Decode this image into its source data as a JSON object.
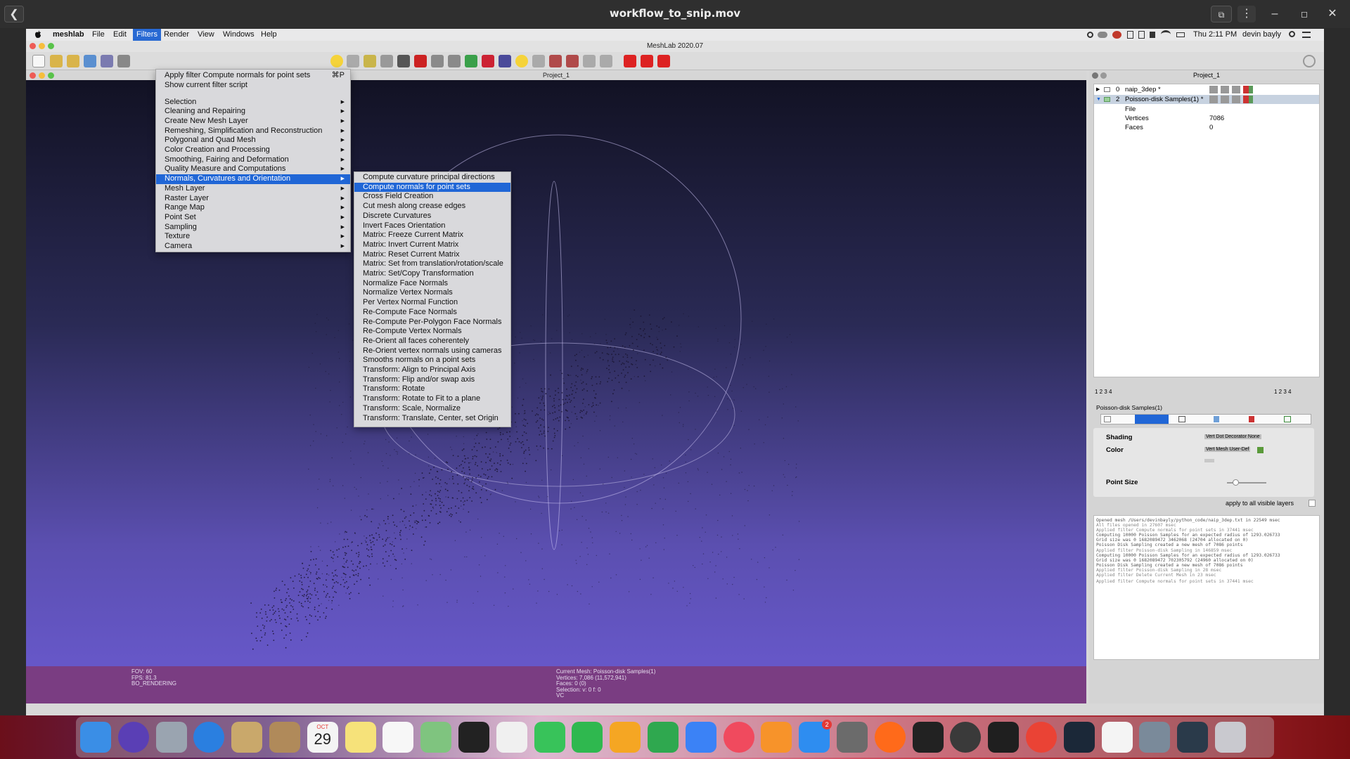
{
  "player": {
    "title": "workflow_to_snip.mov",
    "back_label": "❮",
    "right_box_label": "⧉",
    "menu_label": "⋮",
    "minimize_label": "–",
    "maximize_label": "◻",
    "close_label": "✕"
  },
  "menubar": {
    "app": "meshlab",
    "items": [
      "File",
      "Edit",
      "Filters",
      "Render",
      "View",
      "Windows",
      "Help"
    ],
    "active": "Filters",
    "clock": "Thu 2:11 PM",
    "user": "devin bayly"
  },
  "window": {
    "title": "MeshLab 2020.07"
  },
  "viewport": {
    "title": "Project_1",
    "fov": "FOV: 60",
    "fps": "FPS:   81.3",
    "rendering": "BO_RENDERING",
    "current_mesh": "Current Mesh: Poisson-disk Samples(1)",
    "vertices": "Vertices: 7,086     (11,572,941)",
    "faces": "Faces: 0      (0)",
    "selection": "Selection: v: 0 f: 0",
    "vc": "VC"
  },
  "filters_menu": {
    "top_items": [
      {
        "label": "Apply filter Compute normals for point sets",
        "shortcut": "⌘P"
      },
      {
        "label": "Show current filter script",
        "shortcut": ""
      }
    ],
    "categories": [
      "Selection",
      "Cleaning and Repairing",
      "Create New Mesh Layer",
      "Remeshing, Simplification and Reconstruction",
      "Polygonal and Quad Mesh",
      "Color Creation and Processing",
      "Smoothing, Fairing and Deformation",
      "Quality Measure and Computations",
      "Normals, Curvatures and Orientation",
      "Mesh Layer",
      "Raster Layer",
      "Range Map",
      "Point Set",
      "Sampling",
      "Texture",
      "Camera"
    ],
    "highlighted_category": "Normals, Curvatures and Orientation"
  },
  "normals_submenu": {
    "items": [
      "Compute curvature principal directions",
      "Compute normals for point sets",
      "Cross Field Creation",
      "Cut mesh along crease edges",
      "Discrete Curvatures",
      "Invert Faces Orientation",
      "Matrix: Freeze Current Matrix",
      "Matrix: Invert Current Matrix",
      "Matrix: Reset Current Matrix",
      "Matrix: Set from translation/rotation/scale",
      "Matrix: Set/Copy Transformation",
      "Normalize Face Normals",
      "Normalize Vertex Normals",
      "Per Vertex Normal Function",
      "Re-Compute Face Normals",
      "Re-Compute Per-Polygon Face Normals",
      "Re-Compute Vertex Normals",
      "Re-Orient all faces coherentely",
      "Re-Orient vertex normals using cameras",
      "Smooths normals on a point sets",
      "Transform: Align to Principal Axis",
      "Transform: Flip and/or swap axis",
      "Transform: Rotate",
      "Transform: Rotate to Fit to a plane",
      "Transform: Scale, Normalize",
      "Transform: Translate, Center, set Origin"
    ],
    "highlighted": "Compute normals for point sets"
  },
  "right_panel": {
    "title": "Project_1",
    "layers": [
      {
        "index": "0",
        "name": "naip_3dep *"
      },
      {
        "index": "2",
        "name": "Poisson-disk Samples(1) *"
      }
    ],
    "details": {
      "file_label": "File",
      "vertices_label": "Vertices",
      "vertices_value": "7086",
      "faces_label": "Faces",
      "faces_value": "0"
    },
    "page_nums_left": "1    2    3    4",
    "page_nums_right": "1    2    3    4",
    "props_title": "Poisson-disk Samples(1)",
    "shading_label": "Shading",
    "shading_opts": "Vert   Dot Decorator   None",
    "color_label": "Color",
    "color_opts": "Vert   Mesh   User-Def",
    "point_size_label": "Point Size",
    "apply_all_label": "apply to all visible layers",
    "log_lines": [
      "Opened mesh /Users/devinbayly/python_code/naip_3dep.txt in 22549 msec",
      "All files opened in 27607 msec",
      "Applied filter Compute normals for point sets in 37441 msec",
      "Computing 10000 Poisson Samples for an expected radius of 1293.026733",
      "Grid size was 0 1682089472 3462068 (24704 allocated on 0)",
      "Poisson Disk Sampling created a new mesh of 7086 points",
      "Applied filter Poisson-disk Sampling in 146859 msec",
      "Computing 10000 Poisson Samples for an expected radius of 1293.026733",
      "Grid size was 0 1682089472 702305792 (24960 allocated on 0)",
      "Poisson Disk Sampling created a new mesh of 7086 points",
      "Applied filter Poisson-disk Sampling in 28 msec",
      "Applied filter Delete Current Mesh in 23 msec",
      "Applied filter Compute normals for point sets in 37441 msec"
    ]
  },
  "dock": {
    "badge_count": "2",
    "calendar_day": "29",
    "calendar_month": "OCT",
    "icons": [
      "finder-icon",
      "siri-icon",
      "launchpad-icon",
      "safari-icon",
      "mail-icon",
      "contacts-icon",
      "calendar-icon",
      "notes-icon",
      "reminders-icon",
      "maps-icon",
      "meshlab-icon",
      "photos-icon",
      "messages-icon",
      "facetime-icon",
      "pages-icon",
      "numbers-icon",
      "keynote-icon",
      "music-icon",
      "books-icon",
      "app-store-icon",
      "system-preferences-icon",
      "firefox-icon",
      "activity-monitor-icon",
      "obs-icon",
      "terminal-icon",
      "chrome-icon",
      "steam-icon",
      "textedit-icon",
      "preview-icon",
      "quicktime-icon",
      "trash-icon"
    ],
    "colors": {
      "finder": "#3a8ee6",
      "siri": "#5a3fb5",
      "launchpad": "#9aa4b0",
      "safari": "#2a7fe0",
      "mail": "#c9a86b",
      "contacts": "#b08a5a",
      "calendar": "#f4f4f4",
      "notes": "#f6e27a",
      "reminders": "#f7f7f7",
      "maps": "#7fc47f",
      "meshlab": "#222222",
      "photos": "#f0f0f0",
      "messages": "#38c35a",
      "facetime": "#2fb84f",
      "pages": "#f5a623",
      "numbers": "#2fa84f",
      "keynote": "#3b82f6",
      "music": "#f04a5e",
      "books": "#f7932a",
      "app-store": "#2e8df0",
      "system-preferences": "#6b6b6b",
      "firefox": "#ff6a1a",
      "activity-monitor": "#222222",
      "obs": "#3a3a3a",
      "terminal": "#1f1f1f",
      "chrome": "#ea4335",
      "steam": "#1b2838",
      "textedit": "#f4f4f4",
      "preview": "#7a8a9a",
      "quicktime": "#2a3a4a",
      "trash": "#c9c9cf"
    }
  },
  "colors": {
    "highlight": "#2066d6",
    "viewport_bottom": "#6a5ad0",
    "info_bar": "#7a3d82"
  }
}
